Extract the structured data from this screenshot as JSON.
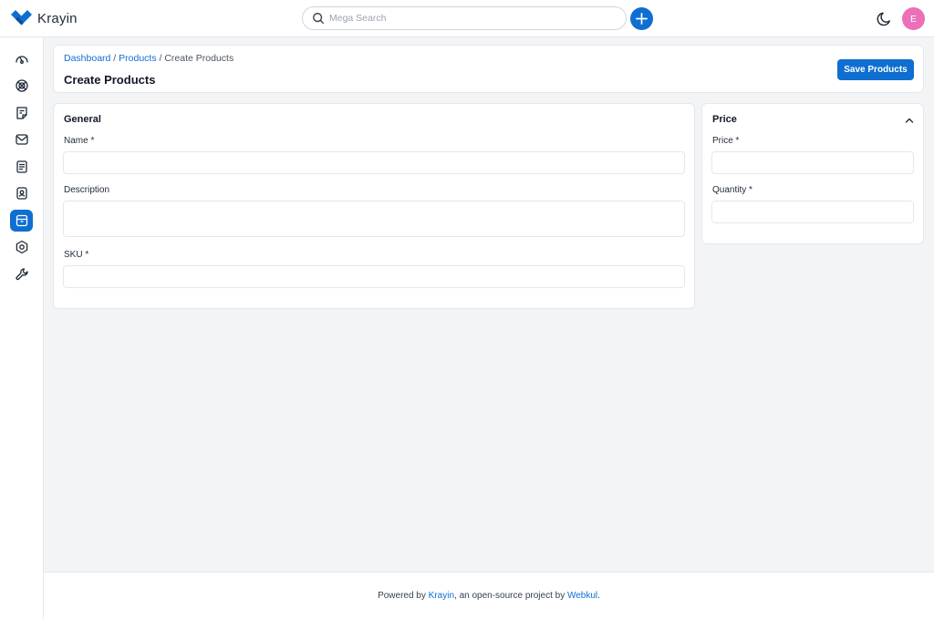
{
  "app": {
    "name": "Krayin",
    "brand_color": "#0e6fd1",
    "avatar_color": "#ec6fb8"
  },
  "topbar": {
    "search_placeholder": "Mega Search",
    "avatar_initial": "E"
  },
  "sidebar": {
    "items": [
      {
        "name": "dashboard",
        "icon": "gauge-icon",
        "active": false
      },
      {
        "name": "leads",
        "icon": "leads-icon",
        "active": false
      },
      {
        "name": "quotes",
        "icon": "quote-icon",
        "active": false
      },
      {
        "name": "mail",
        "icon": "mail-icon",
        "active": false
      },
      {
        "name": "activities",
        "icon": "activity-icon",
        "active": false
      },
      {
        "name": "contacts",
        "icon": "contact-icon",
        "active": false
      },
      {
        "name": "products",
        "icon": "product-icon",
        "active": true
      },
      {
        "name": "settings",
        "icon": "gear-icon",
        "active": false
      },
      {
        "name": "configuration",
        "icon": "wrench-icon",
        "active": false
      }
    ]
  },
  "header": {
    "breadcrumb": {
      "dashboard": "Dashboard",
      "products": "Products",
      "current": "Create Products",
      "separator": "/"
    },
    "title": "Create Products",
    "save_label": "Save Products"
  },
  "general": {
    "title": "General",
    "name_label": "Name *",
    "name_value": "",
    "description_label": "Description",
    "description_value": "",
    "sku_label": "SKU *",
    "sku_value": ""
  },
  "price": {
    "title": "Price",
    "price_label": "Price *",
    "price_value": "",
    "quantity_label": "Quantity *",
    "quantity_value": ""
  },
  "footer": {
    "prefix": "Powered by ",
    "krayin_link": "Krayin",
    "middle": ", an open-source project by ",
    "webkul_link": "Webkul",
    "suffix": "."
  }
}
